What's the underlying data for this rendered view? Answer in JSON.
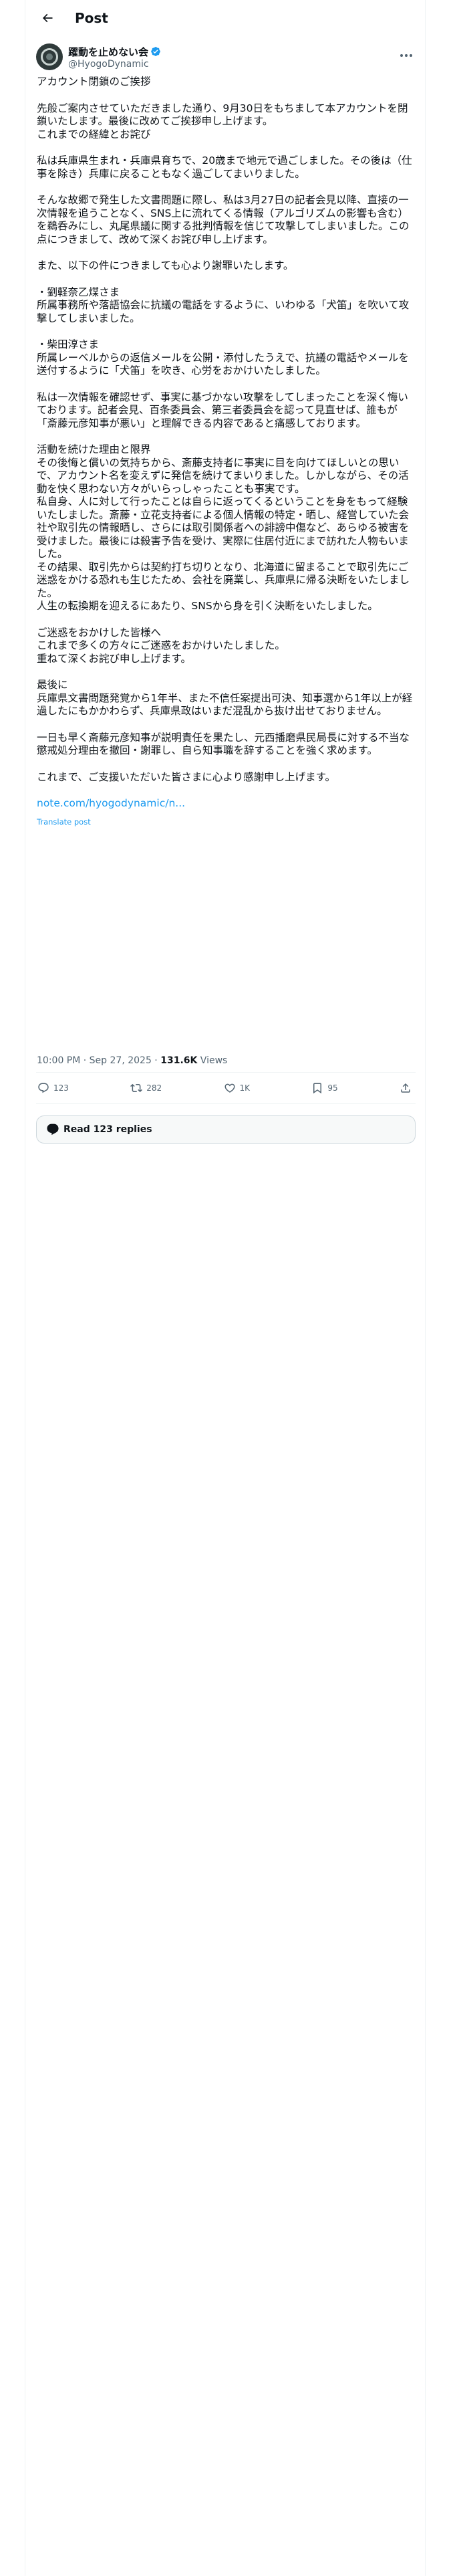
{
  "header": {
    "title": "Post"
  },
  "author": {
    "display_name": "躍動を止めない会",
    "handle": "@HyogoDynamic"
  },
  "post": {
    "paragraphs": [
      "アカウント閉鎖のご挨拶",
      "先般ご案内させていただきました通り、9月30日をもちまして本アカウントを閉鎖いたします。最後に改めてご挨拶申し上げます。\nこれまでの経緯とお詫び",
      "私は兵庫県生まれ・兵庫県育ちで、20歳まで地元で過ごしました。その後は（仕事を除き）兵庫に戻ることもなく過ごしてまいりました。",
      "そんな故郷で発生した文書問題に際し、私は3月27日の記者会見以降、直接の一次情報を追うことなく、SNS上に流れてくる情報（アルゴリズムの影響も含む）を鵜呑みにし、丸尾県議に関する批判情報を信じて攻撃してしまいました。この点につきまして、改めて深くお詫び申し上げます。",
      "また、以下の件につきましても心より謝罪いたします。",
      "・劉軽奈乙煤さま\n所属事務所や落語協会に抗議の電話をするように、いわゆる「犬笛」を吹いて攻撃してしまいました。",
      "・柴田淳さま\n所属レーベルからの返信メールを公開・添付したうえで、抗議の電話やメールを送付するように「犬笛」を吹き、心労をおかけいたしました。",
      "私は一次情報を確認せず、事実に基づかない攻撃をしてしまったことを深く悔いております。記者会見、百条委員会、第三者委員会を認って見直せば、誰もが「斎藤元彦知事が悪い」と理解できる内容であると痛感しております。",
      "活動を続けた理由と限界\nその後悔と償いの気持ちから、斎藤支持者に事実に目を向けてほしいとの思いで、アカウント名を変えずに発信を続けてまいりました。しかしながら、その活動を快く思わない方々がいらっしゃったことも事実です。\n私自身、人に対して行ったことは自らに返ってくるということを身をもって経験いたしました。斎藤・立花支持者による個人情報の特定・晒し、経営していた会社や取引先の情報晒し、さらには取引関係者への誹謗中傷など、あらゆる被害を受けました。最後には殺害予告を受け、実際に住居付近にまで訪れた人物もいました。\nその結果、取引先からは契約打ち切りとなり、北海道に留まることで取引先にご迷惑をかける恐れも生じたため、会社を廃業し、兵庫県に帰る決断をいたしました。\n人生の転換期を迎えるにあたり、SNSから身を引く決断をいたしました。",
      "ご迷惑をおかけした皆様へ\nこれまで多くの方々にご迷惑をおかけいたしました。\n重ねて深くお詫び申し上げます。",
      "最後に\n兵庫県文書問題発覚から1年半、また不信任案提出可決、知事選から1年以上が経過したにもかかわらず、兵庫県政はいまだ混乱から抜け出せておりません。",
      "一日も早く斎藤元彦知事が説明責任を果たし、元西播磨県民局長に対する不当な懲戒処分理由を撤回・謝罪し、自ら知事職を辞することを強く求めます。",
      "これまで、ご支援いただいた皆さまに心より感謝申し上げます。"
    ],
    "link_text": "note.com/hyogodynamic/n...",
    "translate_label": "Translate post",
    "time": "10:00 PM · Sep 27, 2025",
    "separator": " · ",
    "views_count": "131.6K",
    "views_label": " Views"
  },
  "actions": {
    "replies": "123",
    "reposts": "282",
    "likes": "1K",
    "bookmarks": "95"
  },
  "read_replies_label": "Read 123 replies",
  "colors": {
    "accent": "#1d9bf0",
    "secondary": "#536471",
    "border": "#eff3f4"
  }
}
